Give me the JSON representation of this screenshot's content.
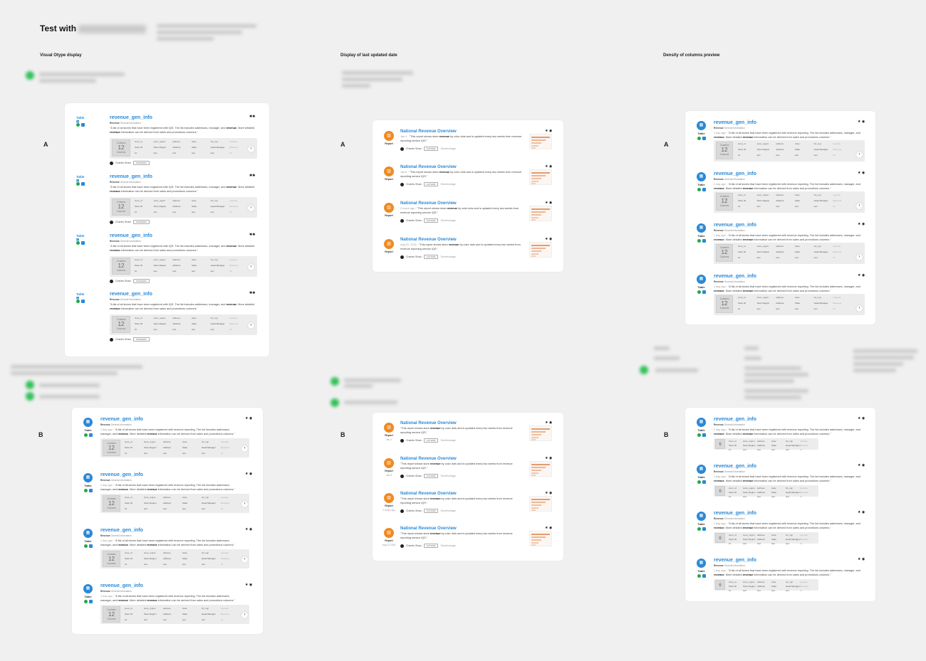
{
  "header": {
    "title": "Test with"
  },
  "columns": [
    {
      "title": "Visual Otype display"
    },
    {
      "title": "Display of last updated date"
    },
    {
      "title": "Density of columns preview"
    }
  ],
  "variants": {
    "a": "A",
    "b": "B"
  },
  "table_card": {
    "icon": "table-icon",
    "type_label": "Table",
    "title_a": "revenue",
    "title_b": "_gen_info",
    "sub_prefix": "Revenue",
    "sub_suffix": "General Information",
    "time_ago": "1 day ago",
    "desc_1": "\"A list of all stores that have been registered with revenue reporting. The list includes addresses, manager, and",
    "desc_2": "revenue",
    "desc_3": ". More detailed",
    "desc_4": "revenue",
    "desc_5": "information can be derived from sales and promotions columns.\"",
    "desc_a_1": "\"A list of all stores that have been registered with IQS. The list includes addresses, manager, and",
    "contains_label": "Contains",
    "column_count": "12",
    "columns_label": "Columns",
    "dense_count": "6",
    "col_keys": [
      "store_id",
      "store_region",
      "address",
      "state",
      "hd_mgr",
      "revenue"
    ],
    "col_names": [
      "Store ID",
      "Store Region",
      "Address",
      "State",
      "Head Manager",
      "Revenue"
    ],
    "col_types": [
      "int",
      "text",
      "text",
      "text",
      "text",
      "int"
    ],
    "owner": "Charles Shaw",
    "badge": "STEWARD",
    "more_icon": "chevron-right-icon"
  },
  "report_card": {
    "icon": "bar-chart-icon",
    "type_label": "Report",
    "title_a": "National ",
    "title_b": "Revenue",
    "title_c": " Overview",
    "desc_1": "\"This report shows store",
    "desc_2": "revenue",
    "desc_3": "by color dots and is updated every two weeks from revenue reporting service IQS.\"",
    "owner": "Charles Shaw",
    "badge": "AUTHOR",
    "tag": "Storefrontage",
    "dates_a": [
      "Jan 4",
      "Jan 8",
      "2 hours ago",
      "Aug 22, 2016"
    ],
    "dates_b": [
      "Jan 4",
      "Jan 8",
      "2 hours ago",
      "Aug 22 2016"
    ]
  },
  "colors": {
    "accent": "#2a89d6",
    "report": "#f08a21",
    "ok": "#21a84a",
    "legend_green": "#35c15b"
  }
}
